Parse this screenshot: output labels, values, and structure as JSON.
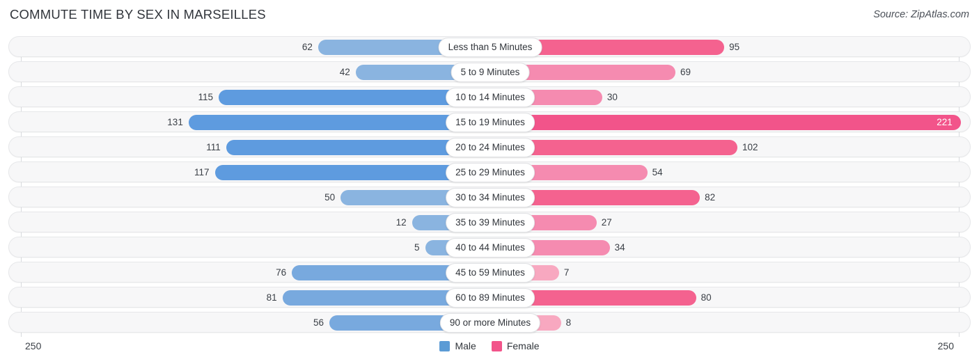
{
  "header": {
    "title": "COMMUTE TIME BY SEX IN MARSEILLES",
    "source": "Source: ZipAtlas.com"
  },
  "axis": {
    "left_cap": "250",
    "right_cap": "250",
    "max": 250
  },
  "legend": {
    "items": [
      {
        "label": "Male",
        "color": "#5b9bd5"
      },
      {
        "label": "Female",
        "color": "#f2548a"
      }
    ]
  },
  "colors": {
    "male_light": "#8ab4e0",
    "male_mid": "#78a9de",
    "male_dark": "#5e9bdf",
    "female_light": "#f8a8c0",
    "female_mid": "#f58bb0",
    "female_dark": "#f4628f",
    "female_max": "#f2548a",
    "track": "#f7f7f8",
    "track_border": "#e6e7e9",
    "axis": "#d8dade",
    "text": "#31353b"
  },
  "chart_data": {
    "type": "bar",
    "orientation": "horizontal-diverging",
    "title": "COMMUTE TIME BY SEX IN MARSEILLES",
    "subtitle": "Source: ZipAtlas.com",
    "xlabel": "",
    "ylabel": "",
    "xlim": [
      -250,
      250
    ],
    "axis_caps": [
      "250",
      "250"
    ],
    "grid": false,
    "legend_position": "bottom-center",
    "categories": [
      "Less than 5 Minutes",
      "5 to 9 Minutes",
      "10 to 14 Minutes",
      "15 to 19 Minutes",
      "20 to 24 Minutes",
      "25 to 29 Minutes",
      "30 to 34 Minutes",
      "35 to 39 Minutes",
      "40 to 44 Minutes",
      "45 to 59 Minutes",
      "60 to 89 Minutes",
      "90 or more Minutes"
    ],
    "series": [
      {
        "name": "Male",
        "color": "#5b9bd5",
        "side": "left",
        "values": [
          62,
          42,
          115,
          131,
          111,
          117,
          50,
          12,
          5,
          76,
          81,
          56
        ]
      },
      {
        "name": "Female",
        "color": "#f2548a",
        "side": "right",
        "values": [
          95,
          69,
          30,
          221,
          102,
          54,
          82,
          27,
          34,
          7,
          80,
          8
        ]
      }
    ]
  },
  "rows": [
    {
      "label": "Less than 5 Minutes",
      "male": 62,
      "female": 95,
      "male_shade": "male_light",
      "female_shade": "female_dark",
      "female_inside": false
    },
    {
      "label": "5 to 9 Minutes",
      "male": 42,
      "female": 69,
      "male_shade": "male_light",
      "female_shade": "female_mid",
      "female_inside": false
    },
    {
      "label": "10 to 14 Minutes",
      "male": 115,
      "female": 30,
      "male_shade": "male_dark",
      "female_shade": "female_mid",
      "female_inside": false
    },
    {
      "label": "15 to 19 Minutes",
      "male": 131,
      "female": 221,
      "male_shade": "male_dark",
      "female_shade": "female_max",
      "female_inside": true
    },
    {
      "label": "20 to 24 Minutes",
      "male": 111,
      "female": 102,
      "male_shade": "male_dark",
      "female_shade": "female_dark",
      "female_inside": false
    },
    {
      "label": "25 to 29 Minutes",
      "male": 117,
      "female": 54,
      "male_shade": "male_dark",
      "female_shade": "female_mid",
      "female_inside": false
    },
    {
      "label": "30 to 34 Minutes",
      "male": 50,
      "female": 82,
      "male_shade": "male_light",
      "female_shade": "female_dark",
      "female_inside": false
    },
    {
      "label": "35 to 39 Minutes",
      "male": 12,
      "female": 27,
      "male_shade": "male_light",
      "female_shade": "female_mid",
      "female_inside": false
    },
    {
      "label": "40 to 44 Minutes",
      "male": 5,
      "female": 34,
      "male_shade": "male_light",
      "female_shade": "female_mid",
      "female_inside": false
    },
    {
      "label": "45 to 59 Minutes",
      "male": 76,
      "female": 7,
      "male_shade": "male_mid",
      "female_shade": "female_light",
      "female_inside": false
    },
    {
      "label": "60 to 89 Minutes",
      "male": 81,
      "female": 80,
      "male_shade": "male_mid",
      "female_shade": "female_dark",
      "female_inside": false
    },
    {
      "label": "90 or more Minutes",
      "male": 56,
      "female": 8,
      "male_shade": "male_mid",
      "female_shade": "female_light",
      "female_inside": false
    }
  ]
}
